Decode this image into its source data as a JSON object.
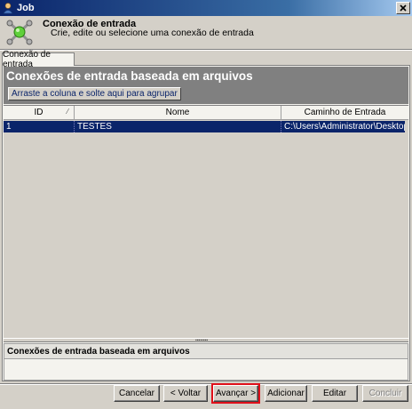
{
  "window": {
    "title": "Job"
  },
  "header": {
    "title": "Conexão de entrada",
    "subtitle": "Crie, edite ou selecione uma conexão de entrada"
  },
  "tabs": [
    {
      "label": "Conexão de entrada"
    }
  ],
  "grid": {
    "title": "Conexões de entrada baseada em arquivos",
    "group_hint": "Arraste a coluna e solte aqui para agrupar",
    "columns": [
      "ID",
      "Nome",
      "Caminho de Entrada"
    ],
    "rows": [
      {
        "id": "1",
        "name": "TESTES",
        "path": "C:\\Users\\Administrator\\Desktop\\TEST"
      }
    ]
  },
  "detail": {
    "title": "Conexões de entrada baseada em arquivos"
  },
  "buttons": {
    "cancel": "Cancelar",
    "back": "< Voltar",
    "next": "Avançar >",
    "add": "Adicionar",
    "edit": "Editar",
    "finish": "Concluir"
  },
  "colors": {
    "selection": "#0a246a",
    "header_bar": "#808080",
    "highlight": "#e0101a"
  }
}
